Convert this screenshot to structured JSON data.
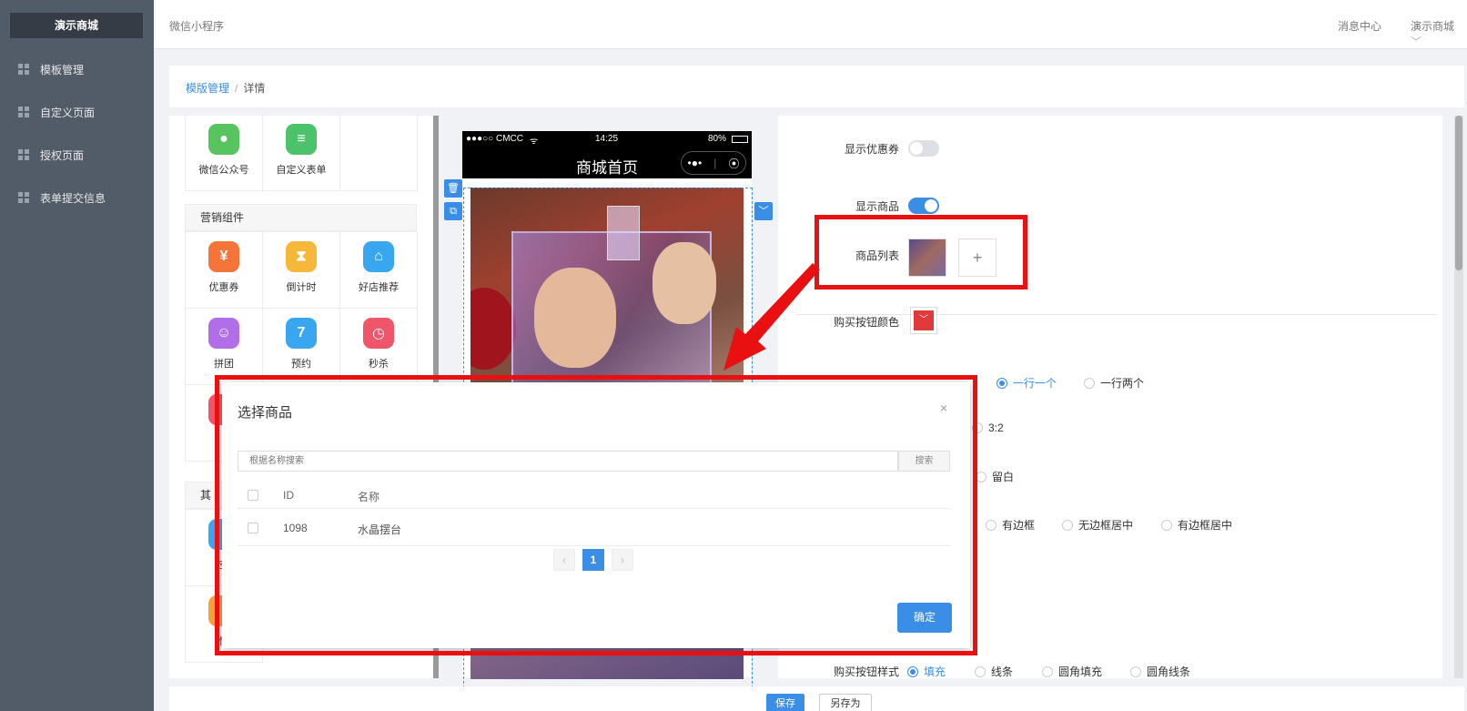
{
  "sidebar": {
    "brand": "演示商城",
    "items": [
      {
        "label": "模板管理"
      },
      {
        "label": "自定义页面"
      },
      {
        "label": "授权页面"
      },
      {
        "label": "表单提交信息"
      }
    ]
  },
  "topbar": {
    "app_title": "微信小程序",
    "message_center": "消息中心",
    "user_menu": "演示商城"
  },
  "breadcrumb": {
    "parent": "模版管理",
    "separator": "/",
    "current": "详情"
  },
  "components": {
    "top_items": [
      {
        "label": "微信公众号",
        "icon": "wechat-icon",
        "color": "#57c45f"
      },
      {
        "label": "自定义表单",
        "icon": "form-icon",
        "color": "#4cc36b"
      }
    ],
    "marketing_title": "营销组件",
    "marketing_items": [
      {
        "label": "优惠券",
        "icon": "coupon-icon",
        "color": "#f5743a"
      },
      {
        "label": "倒计时",
        "icon": "hourglass-icon",
        "color": "#f5b83a"
      },
      {
        "label": "好店推荐",
        "icon": "shop-icon",
        "color": "#39a7f0"
      },
      {
        "label": "拼团",
        "icon": "group-icon",
        "color": "#b16ee8"
      },
      {
        "label": "预约",
        "icon": "calendar-icon",
        "color": "#39a7f0"
      },
      {
        "label": "秒杀",
        "icon": "clock-icon",
        "color": "#f0566a"
      }
    ],
    "other_title_partial": "其",
    "other_items_partial": [
      "空",
      "快"
    ]
  },
  "phone": {
    "carrier": "●●●○○ CMCC",
    "time": "14:25",
    "battery": "80%",
    "page_title": "商城首页",
    "capsule_more": "•●•",
    "capsule_close": "⦿"
  },
  "settings": {
    "show_coupon_label": "显示优惠券",
    "show_coupon": false,
    "show_goods_label": "显示商品",
    "show_goods": true,
    "goods_list_label": "商品列表",
    "add_symbol": "+",
    "buy_button_color_label": "购买按钮颜色",
    "buy_button_color": "#e03a3a",
    "layout_options": [
      "一行一个",
      "一行两个"
    ],
    "layout_selected": "一行一个",
    "ratio_option": "3:2",
    "fill_option": "留白",
    "border_options": [
      "有边框",
      "无边框居中",
      "有边框居中"
    ],
    "buy_button_style_label": "购买按钮样式",
    "buy_button_styles": [
      "填充",
      "线条",
      "圆角填充",
      "圆角线条"
    ],
    "buy_button_style_selected": "填充"
  },
  "footer": {
    "save": "保存",
    "save_as": "另存为"
  },
  "modal": {
    "title": "选择商品",
    "close": "×",
    "search_placeholder": "根据名称搜索",
    "search_button": "搜索",
    "columns": [
      "ID",
      "名称"
    ],
    "rows": [
      {
        "id": "1098",
        "name": "水晶摆台"
      }
    ],
    "page_prev": "‹",
    "page_current": "1",
    "page_next": "›",
    "confirm": "确定"
  },
  "colors": {
    "sidebar": "#525c69",
    "accent": "#3a8ee6",
    "highlight": "#e81010"
  }
}
